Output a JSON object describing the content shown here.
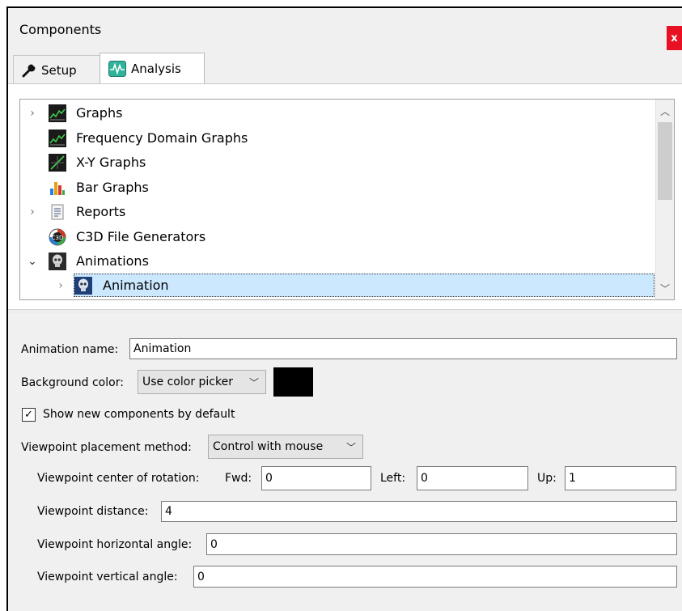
{
  "window": {
    "title": "Components",
    "close_label": "x"
  },
  "tabs": [
    {
      "label": "Setup",
      "icon": "wrench-icon"
    },
    {
      "label": "Analysis",
      "icon": "waveform-icon",
      "active": true
    }
  ],
  "tree": {
    "items": [
      {
        "label": "Graphs",
        "icon": "graph-icon",
        "expander": "collapsed"
      },
      {
        "label": "Frequency Domain Graphs",
        "icon": "graph-icon",
        "expander": "none"
      },
      {
        "label": "X-Y Graphs",
        "icon": "xy-graph-icon",
        "expander": "none"
      },
      {
        "label": "Bar Graphs",
        "icon": "bar-chart-icon",
        "expander": "none"
      },
      {
        "label": "Reports",
        "icon": "report-icon",
        "expander": "collapsed"
      },
      {
        "label": "C3D File Generators",
        "icon": "c3d-icon",
        "expander": "none"
      },
      {
        "label": "Animations",
        "icon": "skull-icon",
        "expander": "expanded"
      },
      {
        "label": "Animation",
        "icon": "skull-icon",
        "expander": "collapsed",
        "selected": true,
        "child": true
      }
    ]
  },
  "props": {
    "animation_name_label": "Animation name:",
    "animation_name_value": "Animation",
    "background_color_label": "Background color:",
    "background_color_mode": "Use color picker",
    "background_color_value": "#000000",
    "show_new_label": "Show new components by default",
    "show_new_checked": true,
    "viewpoint_method_label": "Viewpoint placement method:",
    "viewpoint_method_value": "Control with mouse",
    "center_label": "Viewpoint center of rotation:",
    "fwd_label": "Fwd:",
    "fwd_value": "0",
    "left_label": "Left:",
    "left_value": "0",
    "up_label": "Up:",
    "up_value": "1",
    "distance_label": "Viewpoint distance:",
    "distance_value": "4",
    "horizontal_label": "Viewpoint horizontal angle:",
    "horizontal_value": "0",
    "vertical_label": "Viewpoint vertical angle:",
    "vertical_value": "0"
  }
}
